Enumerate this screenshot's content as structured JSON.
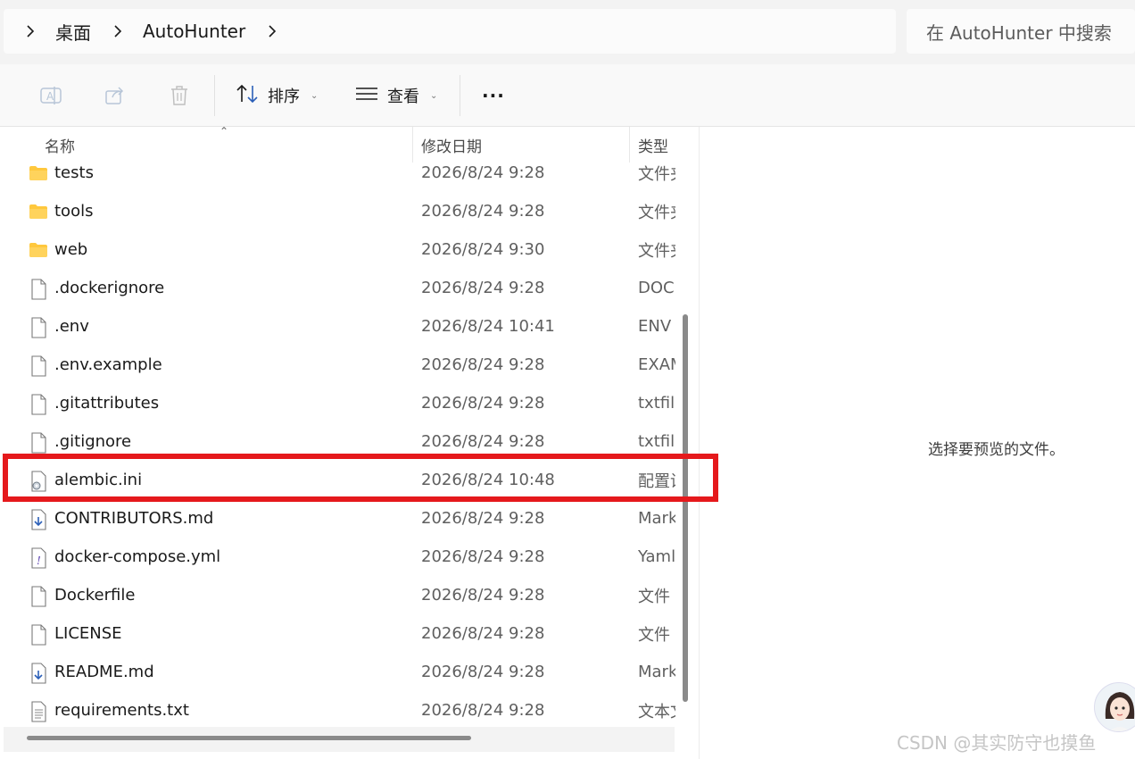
{
  "address": {
    "breadcrumbs": [
      "桌面",
      "AutoHunter"
    ],
    "search_placeholder": "在 AutoHunter 中搜索"
  },
  "toolbar": {
    "sort_label": "排序",
    "view_label": "查看",
    "more_label": "···"
  },
  "columns": {
    "name": "名称",
    "modified": "修改日期",
    "type": "类型"
  },
  "files": [
    {
      "name": "tests",
      "date": "2026/8/24 9:28",
      "type": "文件夹",
      "icon": "folder-icon"
    },
    {
      "name": "tools",
      "date": "2026/8/24 9:28",
      "type": "文件夹",
      "icon": "folder-icon"
    },
    {
      "name": "web",
      "date": "2026/8/24 9:30",
      "type": "文件夹",
      "icon": "folder-icon"
    },
    {
      "name": ".dockerignore",
      "date": "2026/8/24 9:28",
      "type": "DOCKERIGNORE",
      "icon": "file-icon"
    },
    {
      "name": ".env",
      "date": "2026/8/24 10:41",
      "type": "ENV",
      "icon": "file-icon"
    },
    {
      "name": ".env.example",
      "date": "2026/8/24 9:28",
      "type": "EXAMPLE",
      "icon": "file-icon"
    },
    {
      "name": ".gitattributes",
      "date": "2026/8/24 9:28",
      "type": "txtfile",
      "icon": "file-icon"
    },
    {
      "name": ".gitignore",
      "date": "2026/8/24 9:28",
      "type": "txtfile",
      "icon": "file-icon"
    },
    {
      "name": "alembic.ini",
      "date": "2026/8/24 10:48",
      "type": "配置设置",
      "icon": "config-file-icon"
    },
    {
      "name": "CONTRIBUTORS.md",
      "date": "2026/8/24 9:28",
      "type": "Markdown",
      "icon": "markdown-file-icon"
    },
    {
      "name": "docker-compose.yml",
      "date": "2026/8/24 9:28",
      "type": "Yaml",
      "icon": "yaml-file-icon"
    },
    {
      "name": "Dockerfile",
      "date": "2026/8/24 9:28",
      "type": "文件",
      "icon": "file-icon"
    },
    {
      "name": "LICENSE",
      "date": "2026/8/24 9:28",
      "type": "文件",
      "icon": "file-icon"
    },
    {
      "name": "README.md",
      "date": "2026/8/24 9:28",
      "type": "Markdown",
      "icon": "markdown-file-icon"
    },
    {
      "name": "requirements.txt",
      "date": "2026/8/24 9:28",
      "type": "文本文档",
      "icon": "text-file-icon"
    }
  ],
  "preview": {
    "message": "选择要预览的文件。"
  },
  "watermark": "CSDN @其实防守也摸鱼",
  "colors": {
    "highlight": "#e5191c",
    "folder": "#ffc83d"
  }
}
